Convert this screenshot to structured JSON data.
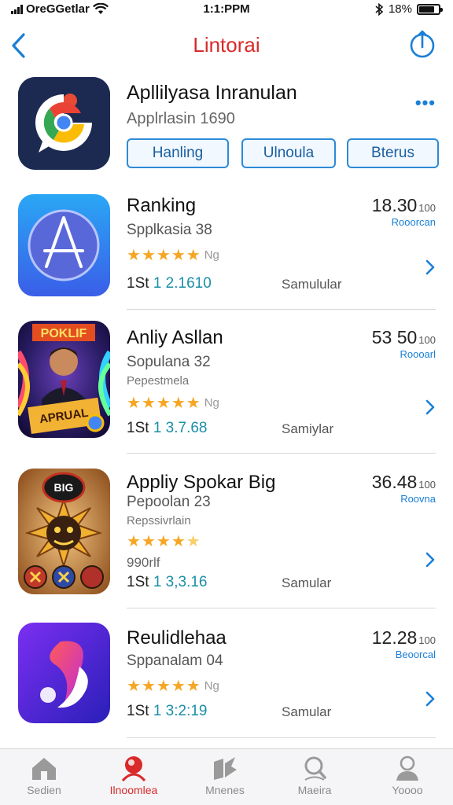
{
  "status_bar": {
    "carrier": "OreGGetlar",
    "time": "1:1:PPM",
    "battery_text": "18%"
  },
  "nav": {
    "title": "Lintorai",
    "back_icon": "chevron-left-icon",
    "share_icon": "share-icon"
  },
  "featured": {
    "title": "Apllilyasa Inranulan",
    "subtitle": "Applrlasin 1690",
    "more_icon": "ellipsis-icon",
    "buttons": [
      "Hanling",
      "Ulnoula",
      "Bterus"
    ]
  },
  "apps": [
    {
      "title": "Ranking",
      "subtitle": "Spplkasia 38",
      "extra": "",
      "stars": 5,
      "rating_count": "Ng",
      "meta_prefix": "1St",
      "meta_value": "1 2.1610",
      "seller": "Samulular",
      "price": "18.30",
      "price_unit": "100",
      "price_sub": "Rooorcan"
    },
    {
      "title": "Anliy Asllan",
      "subtitle": "Sopulana 32",
      "extra": "Pepestmela",
      "stars": 5,
      "rating_count": "Ng",
      "meta_prefix": "1St",
      "meta_value": "1 3.7.68",
      "seller": "Samiylar",
      "price": "53 50",
      "price_unit": "100",
      "price_sub": "Roooarl"
    },
    {
      "title": "Appliy Spokar Big",
      "subtitle": "Pepoolan 23",
      "extra": "Repssivrlain",
      "stars": 4.5,
      "rating_count": "990rlf",
      "meta_prefix": "1St",
      "meta_value": "1 3,3.16",
      "seller": "Samular",
      "price": "36.48",
      "price_unit": "100",
      "price_sub": "Roovna"
    },
    {
      "title": "Reulidlehaa",
      "subtitle": "Sppanalam 04",
      "extra": "",
      "stars": 5,
      "rating_count": "Ng",
      "meta_prefix": "1St",
      "meta_value": "1 3:2:19",
      "seller": "Samular",
      "price": "12.28",
      "price_unit": "100",
      "price_sub": "Beoorcal"
    }
  ],
  "tabs": [
    {
      "label": "Sedien",
      "icon": "home-icon",
      "active": false
    },
    {
      "label": "Ilnoomlea",
      "icon": "featured-icon",
      "active": true
    },
    {
      "label": "Mnenes",
      "icon": "apps-icon",
      "active": false
    },
    {
      "label": "Maeira",
      "icon": "search-icon",
      "active": false
    },
    {
      "label": "Yoooo",
      "icon": "profile-icon",
      "active": false
    }
  ],
  "colors": {
    "accent_red": "#d92a2a",
    "accent_blue": "#1a7fd6",
    "star": "#f5a623"
  }
}
